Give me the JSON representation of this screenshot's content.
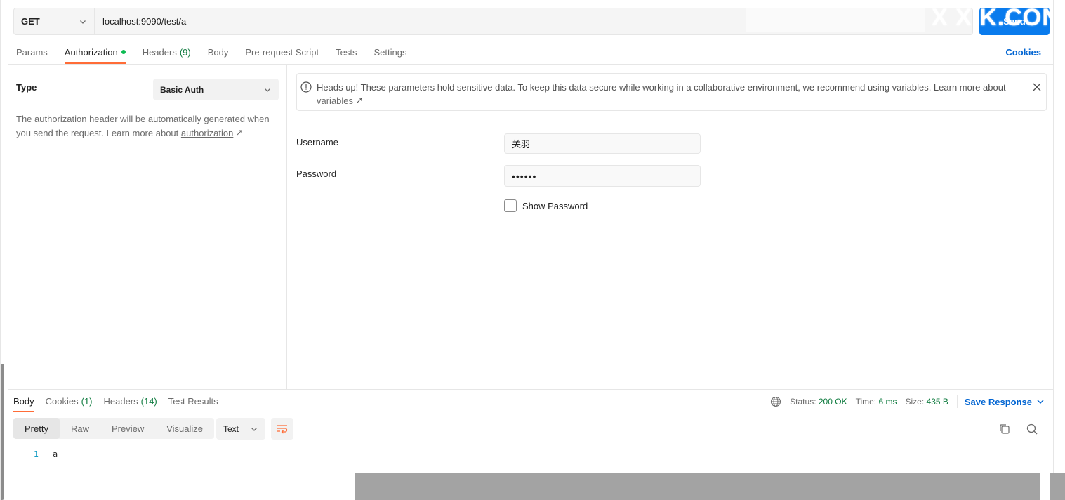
{
  "request": {
    "method": "GET",
    "url": "localhost:9090/test/a",
    "send_label": "Send",
    "watermark": "X X K.CON"
  },
  "tabs": [
    {
      "label": "Params"
    },
    {
      "label": "Authorization"
    },
    {
      "label": "Headers",
      "count": "(9)"
    },
    {
      "label": "Body"
    },
    {
      "label": "Pre-request Script"
    },
    {
      "label": "Tests"
    },
    {
      "label": "Settings"
    }
  ],
  "cookies_label": "Cookies",
  "auth": {
    "type_label": "Type",
    "type_value": "Basic Auth",
    "description": "The authorization header will be automatically generated when you send the request. Learn more about ",
    "description_link": "authorization",
    "alert_text": "Heads up! These parameters hold sensitive data. To keep this data secure while working in a collaborative environment, we recommend using variables. Learn more about ",
    "alert_link": "variables",
    "username_label": "Username",
    "username_value": "关羽",
    "password_label": "Password",
    "password_value": "••••••",
    "show_password_label": "Show Password"
  },
  "response": {
    "tabs": [
      {
        "label": "Body"
      },
      {
        "label": "Cookies",
        "count": "(1)"
      },
      {
        "label": "Headers",
        "count": "(14)"
      },
      {
        "label": "Test Results"
      }
    ],
    "status_label": "Status:",
    "status_value": "200 OK",
    "time_label": "Time:",
    "time_value": "6 ms",
    "size_label": "Size:",
    "size_value": "435 B",
    "save_label": "Save Response",
    "views": [
      "Pretty",
      "Raw",
      "Preview",
      "Visualize"
    ],
    "format": "Text",
    "lines": [
      {
        "num": "1",
        "text": "a"
      }
    ]
  },
  "colors": {
    "accent": "#ff6c37",
    "primary": "#097bed",
    "link": "#0265d2",
    "success": "#0f7b3f"
  }
}
